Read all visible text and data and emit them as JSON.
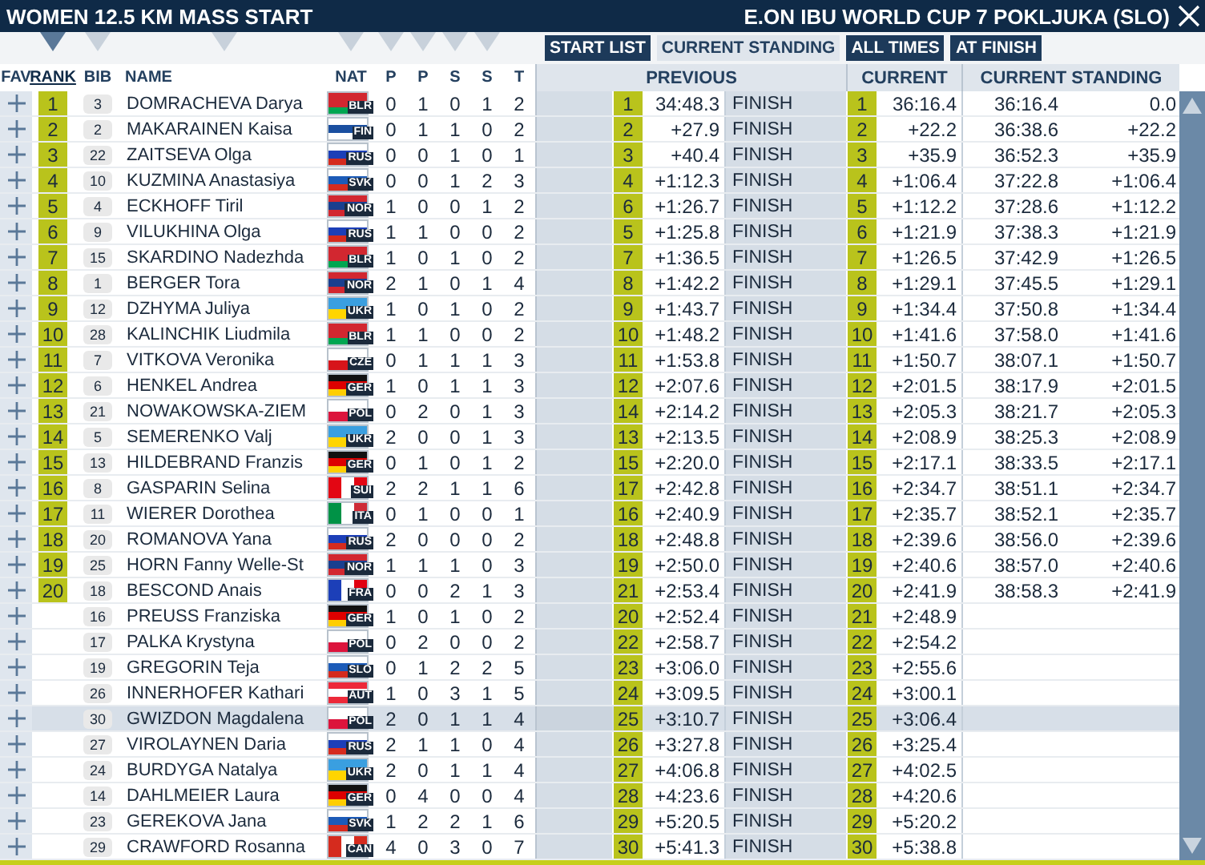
{
  "window": {
    "title": "WOMEN 12.5 KM MASS START",
    "event": "E.ON IBU WORLD CUP 7 POKLJUKA (SLO)"
  },
  "view_buttons": [
    {
      "label": "START LIST",
      "selected": false
    },
    {
      "label": "CURRENT STANDING",
      "selected": true
    },
    {
      "label": "ALL TIMES",
      "selected": false
    },
    {
      "label": "AT FINISH",
      "selected": false
    }
  ],
  "columns": [
    {
      "label": "FAV",
      "sortable": false,
      "selected": false
    },
    {
      "label": "RANK",
      "sortable": true,
      "selected": true
    },
    {
      "label": "BIB",
      "sortable": true,
      "selected": false
    },
    {
      "label": "NAME",
      "sortable": true,
      "selected": false
    },
    {
      "label": "NAT",
      "sortable": true,
      "selected": false
    },
    {
      "label": "P",
      "sortable": true,
      "selected": false
    },
    {
      "label": "P",
      "sortable": true,
      "selected": false
    },
    {
      "label": "S",
      "sortable": true,
      "selected": false
    },
    {
      "label": "S",
      "sortable": true,
      "selected": false
    },
    {
      "label": "T",
      "sortable": false,
      "selected": false
    }
  ],
  "groups": [
    {
      "label": "PREVIOUS"
    },
    {
      "label": "CURRENT"
    },
    {
      "label": "CURRENT STANDING"
    }
  ],
  "rows": [
    {
      "rank": "1",
      "bib": "3",
      "name": "DOMRACHEVA Darya",
      "nat": "BLR",
      "flag": [
        {
          "color": "#d22730"
        },
        {
          "color": "#d22730"
        },
        {
          "color": "#00a651"
        }
      ],
      "flag_vertical": false,
      "shots": [
        "0",
        "1",
        "0",
        "1"
      ],
      "total": "2",
      "prev_rank": "1",
      "prev_time": "34:48.3",
      "status": "FINISH",
      "cur_rank": "1",
      "cur_time": "36:16.4",
      "standing_time": "36:16.4",
      "standing_behind": "0.0",
      "selected": false
    },
    {
      "rank": "2",
      "bib": "2",
      "name": "MAKARAINEN Kaisa",
      "nat": "FIN",
      "flag": [
        {
          "color": "#ffffff"
        },
        {
          "color": "#1a4fa0"
        },
        {
          "color": "#ffffff"
        }
      ],
      "flag_vertical": false,
      "shots": [
        "0",
        "1",
        "1",
        "0"
      ],
      "total": "2",
      "prev_rank": "2",
      "prev_time": "+27.9",
      "status": "FINISH",
      "cur_rank": "2",
      "cur_time": "+22.2",
      "standing_time": "36:38.6",
      "standing_behind": "+22.2",
      "selected": false
    },
    {
      "rank": "3",
      "bib": "22",
      "name": "ZAITSEVA Olga",
      "nat": "RUS",
      "flag": [
        {
          "color": "#ffffff"
        },
        {
          "color": "#1c3fb8"
        },
        {
          "color": "#d52b1e"
        }
      ],
      "flag_vertical": false,
      "shots": [
        "0",
        "0",
        "1",
        "0"
      ],
      "total": "1",
      "prev_rank": "3",
      "prev_time": "+40.4",
      "status": "FINISH",
      "cur_rank": "3",
      "cur_time": "+35.9",
      "standing_time": "36:52.3",
      "standing_behind": "+35.9",
      "selected": false
    },
    {
      "rank": "4",
      "bib": "10",
      "name": "KUZMINA Anastasiya",
      "nat": "SVK",
      "flag": [
        {
          "color": "#ffffff"
        },
        {
          "color": "#1c5bb8"
        },
        {
          "color": "#d52b1e"
        }
      ],
      "flag_vertical": false,
      "shots": [
        "0",
        "0",
        "1",
        "2"
      ],
      "total": "3",
      "prev_rank": "4",
      "prev_time": "+1:12.3",
      "status": "FINISH",
      "cur_rank": "4",
      "cur_time": "+1:06.4",
      "standing_time": "37:22.8",
      "standing_behind": "+1:06.4",
      "selected": false
    },
    {
      "rank": "5",
      "bib": "4",
      "name": "ECKHOFF Tiril",
      "nat": "NOR",
      "flag": [
        {
          "color": "#d22730"
        },
        {
          "color": "#1a3f8f"
        },
        {
          "color": "#d22730"
        }
      ],
      "flag_vertical": false,
      "shots": [
        "1",
        "0",
        "0",
        "1"
      ],
      "total": "2",
      "prev_rank": "6",
      "prev_time": "+1:26.7",
      "status": "FINISH",
      "cur_rank": "5",
      "cur_time": "+1:12.2",
      "standing_time": "37:28.6",
      "standing_behind": "+1:12.2",
      "selected": false
    },
    {
      "rank": "6",
      "bib": "9",
      "name": "VILUKHINA Olga",
      "nat": "RUS",
      "flag": [
        {
          "color": "#ffffff"
        },
        {
          "color": "#1c3fb8"
        },
        {
          "color": "#d52b1e"
        }
      ],
      "flag_vertical": false,
      "shots": [
        "1",
        "1",
        "0",
        "0"
      ],
      "total": "2",
      "prev_rank": "5",
      "prev_time": "+1:25.8",
      "status": "FINISH",
      "cur_rank": "6",
      "cur_time": "+1:21.9",
      "standing_time": "37:38.3",
      "standing_behind": "+1:21.9",
      "selected": false
    },
    {
      "rank": "7",
      "bib": "15",
      "name": "SKARDINO Nadezhda",
      "nat": "BLR",
      "flag": [
        {
          "color": "#d22730"
        },
        {
          "color": "#d22730"
        },
        {
          "color": "#00a651"
        }
      ],
      "flag_vertical": false,
      "shots": [
        "1",
        "0",
        "1",
        "0"
      ],
      "total": "2",
      "prev_rank": "7",
      "prev_time": "+1:36.5",
      "status": "FINISH",
      "cur_rank": "7",
      "cur_time": "+1:26.5",
      "standing_time": "37:42.9",
      "standing_behind": "+1:26.5",
      "selected": false
    },
    {
      "rank": "8",
      "bib": "1",
      "name": "BERGER Tora",
      "nat": "NOR",
      "flag": [
        {
          "color": "#d22730"
        },
        {
          "color": "#1a3f8f"
        },
        {
          "color": "#d22730"
        }
      ],
      "flag_vertical": false,
      "shots": [
        "2",
        "1",
        "0",
        "1"
      ],
      "total": "4",
      "prev_rank": "8",
      "prev_time": "+1:42.2",
      "status": "FINISH",
      "cur_rank": "8",
      "cur_time": "+1:29.1",
      "standing_time": "37:45.5",
      "standing_behind": "+1:29.1",
      "selected": false
    },
    {
      "rank": "9",
      "bib": "12",
      "name": "DZHYMA Juliya",
      "nat": "UKR",
      "flag": [
        {
          "color": "#3a9fe0"
        },
        {
          "color": "#ffd500"
        }
      ],
      "flag_vertical": false,
      "shots": [
        "1",
        "0",
        "1",
        "0"
      ],
      "total": "2",
      "prev_rank": "9",
      "prev_time": "+1:43.7",
      "status": "FINISH",
      "cur_rank": "9",
      "cur_time": "+1:34.4",
      "standing_time": "37:50.8",
      "standing_behind": "+1:34.4",
      "selected": false
    },
    {
      "rank": "10",
      "bib": "28",
      "name": "KALINCHIK Liudmila",
      "nat": "BLR",
      "flag": [
        {
          "color": "#d22730"
        },
        {
          "color": "#d22730"
        },
        {
          "color": "#00a651"
        }
      ],
      "flag_vertical": false,
      "shots": [
        "1",
        "1",
        "0",
        "0"
      ],
      "total": "2",
      "prev_rank": "10",
      "prev_time": "+1:48.2",
      "status": "FINISH",
      "cur_rank": "10",
      "cur_time": "+1:41.6",
      "standing_time": "37:58.0",
      "standing_behind": "+1:41.6",
      "selected": false
    },
    {
      "rank": "11",
      "bib": "7",
      "name": "VITKOVA Veronika",
      "nat": "CZE",
      "flag": [
        {
          "color": "#ffffff"
        },
        {
          "color": "#d7141a"
        }
      ],
      "flag_vertical": false,
      "shots": [
        "0",
        "1",
        "1",
        "1"
      ],
      "total": "3",
      "prev_rank": "11",
      "prev_time": "+1:53.8",
      "status": "FINISH",
      "cur_rank": "11",
      "cur_time": "+1:50.7",
      "standing_time": "38:07.1",
      "standing_behind": "+1:50.7",
      "selected": false
    },
    {
      "rank": "12",
      "bib": "6",
      "name": "HENKEL Andrea",
      "nat": "GER",
      "flag": [
        {
          "color": "#111111"
        },
        {
          "color": "#dd0000"
        },
        {
          "color": "#ffce00"
        }
      ],
      "flag_vertical": false,
      "shots": [
        "1",
        "0",
        "1",
        "1"
      ],
      "total": "3",
      "prev_rank": "12",
      "prev_time": "+2:07.6",
      "status": "FINISH",
      "cur_rank": "12",
      "cur_time": "+2:01.5",
      "standing_time": "38:17.9",
      "standing_behind": "+2:01.5",
      "selected": false
    },
    {
      "rank": "13",
      "bib": "21",
      "name": "NOWAKOWSKA-ZIEM",
      "nat": "POL",
      "flag": [
        {
          "color": "#ffffff"
        },
        {
          "color": "#dc143c"
        }
      ],
      "flag_vertical": false,
      "shots": [
        "0",
        "2",
        "0",
        "1"
      ],
      "total": "3",
      "prev_rank": "14",
      "prev_time": "+2:14.2",
      "status": "FINISH",
      "cur_rank": "13",
      "cur_time": "+2:05.3",
      "standing_time": "38:21.7",
      "standing_behind": "+2:05.3",
      "selected": false
    },
    {
      "rank": "14",
      "bib": "5",
      "name": "SEMERENKO Valj",
      "nat": "UKR",
      "flag": [
        {
          "color": "#3a9fe0"
        },
        {
          "color": "#ffd500"
        }
      ],
      "flag_vertical": false,
      "shots": [
        "2",
        "0",
        "0",
        "1"
      ],
      "total": "3",
      "prev_rank": "13",
      "prev_time": "+2:13.5",
      "status": "FINISH",
      "cur_rank": "14",
      "cur_time": "+2:08.9",
      "standing_time": "38:25.3",
      "standing_behind": "+2:08.9",
      "selected": false
    },
    {
      "rank": "15",
      "bib": "13",
      "name": "HILDEBRAND Franzis",
      "nat": "GER",
      "flag": [
        {
          "color": "#111111"
        },
        {
          "color": "#dd0000"
        },
        {
          "color": "#ffce00"
        }
      ],
      "flag_vertical": false,
      "shots": [
        "0",
        "1",
        "0",
        "1"
      ],
      "total": "2",
      "prev_rank": "15",
      "prev_time": "+2:20.0",
      "status": "FINISH",
      "cur_rank": "15",
      "cur_time": "+2:17.1",
      "standing_time": "38:33.5",
      "standing_behind": "+2:17.1",
      "selected": false
    },
    {
      "rank": "16",
      "bib": "8",
      "name": "GASPARIN Selina",
      "nat": "SUI",
      "flag": [
        {
          "color": "#e30613"
        },
        {
          "color": "#ffffff"
        },
        {
          "color": "#e30613"
        }
      ],
      "flag_vertical": true,
      "shots": [
        "2",
        "2",
        "1",
        "1"
      ],
      "total": "6",
      "prev_rank": "17",
      "prev_time": "+2:42.8",
      "status": "FINISH",
      "cur_rank": "16",
      "cur_time": "+2:34.7",
      "standing_time": "38:51.1",
      "standing_behind": "+2:34.7",
      "selected": false
    },
    {
      "rank": "17",
      "bib": "11",
      "name": "WIERER Dorothea",
      "nat": "ITA",
      "flag": [
        {
          "color": "#009246"
        },
        {
          "color": "#ffffff"
        },
        {
          "color": "#ce2b37"
        }
      ],
      "flag_vertical": true,
      "shots": [
        "0",
        "1",
        "0",
        "0"
      ],
      "total": "1",
      "prev_rank": "16",
      "prev_time": "+2:40.9",
      "status": "FINISH",
      "cur_rank": "17",
      "cur_time": "+2:35.7",
      "standing_time": "38:52.1",
      "standing_behind": "+2:35.7",
      "selected": false
    },
    {
      "rank": "18",
      "bib": "20",
      "name": "ROMANOVA Yana",
      "nat": "RUS",
      "flag": [
        {
          "color": "#ffffff"
        },
        {
          "color": "#1c3fb8"
        },
        {
          "color": "#d52b1e"
        }
      ],
      "flag_vertical": false,
      "shots": [
        "2",
        "0",
        "0",
        "0"
      ],
      "total": "2",
      "prev_rank": "18",
      "prev_time": "+2:48.8",
      "status": "FINISH",
      "cur_rank": "18",
      "cur_time": "+2:39.6",
      "standing_time": "38:56.0",
      "standing_behind": "+2:39.6",
      "selected": false
    },
    {
      "rank": "19",
      "bib": "25",
      "name": "HORN Fanny Welle-St",
      "nat": "NOR",
      "flag": [
        {
          "color": "#d22730"
        },
        {
          "color": "#1a3f8f"
        },
        {
          "color": "#d22730"
        }
      ],
      "flag_vertical": false,
      "shots": [
        "1",
        "1",
        "1",
        "0"
      ],
      "total": "3",
      "prev_rank": "19",
      "prev_time": "+2:50.0",
      "status": "FINISH",
      "cur_rank": "19",
      "cur_time": "+2:40.6",
      "standing_time": "38:57.0",
      "standing_behind": "+2:40.6",
      "selected": false
    },
    {
      "rank": "20",
      "bib": "18",
      "name": "BESCOND Anais",
      "nat": "FRA",
      "flag": [
        {
          "color": "#1c3fb8"
        },
        {
          "color": "#ffffff"
        },
        {
          "color": "#e1000f"
        }
      ],
      "flag_vertical": true,
      "shots": [
        "0",
        "0",
        "2",
        "1"
      ],
      "total": "3",
      "prev_rank": "21",
      "prev_time": "+2:53.4",
      "status": "FINISH",
      "cur_rank": "20",
      "cur_time": "+2:41.9",
      "standing_time": "38:58.3",
      "standing_behind": "+2:41.9",
      "selected": false
    },
    {
      "bib": "16",
      "name": "PREUSS Franziska",
      "nat": "GER",
      "flag": [
        {
          "color": "#111111"
        },
        {
          "color": "#dd0000"
        },
        {
          "color": "#ffce00"
        }
      ],
      "flag_vertical": false,
      "shots": [
        "1",
        "0",
        "1",
        "0"
      ],
      "total": "2",
      "prev_rank": "20",
      "prev_time": "+2:52.4",
      "status": "FINISH",
      "cur_rank": "21",
      "cur_time": "+2:48.9",
      "selected": false
    },
    {
      "bib": "17",
      "name": "PALKA Krystyna",
      "nat": "POL",
      "flag": [
        {
          "color": "#ffffff"
        },
        {
          "color": "#dc143c"
        }
      ],
      "flag_vertical": false,
      "shots": [
        "0",
        "2",
        "0",
        "0"
      ],
      "total": "2",
      "prev_rank": "22",
      "prev_time": "+2:58.7",
      "status": "FINISH",
      "cur_rank": "22",
      "cur_time": "+2:54.2",
      "selected": false
    },
    {
      "bib": "19",
      "name": "GREGORIN Teja",
      "nat": "SLO",
      "flag": [
        {
          "color": "#ffffff"
        },
        {
          "color": "#1c5bb8"
        },
        {
          "color": "#d52b1e"
        }
      ],
      "flag_vertical": false,
      "shots": [
        "0",
        "1",
        "2",
        "2"
      ],
      "total": "5",
      "prev_rank": "23",
      "prev_time": "+3:06.0",
      "status": "FINISH",
      "cur_rank": "23",
      "cur_time": "+2:55.6",
      "selected": false
    },
    {
      "bib": "26",
      "name": "INNERHOFER Kathari",
      "nat": "AUT",
      "flag": [
        {
          "color": "#ed2939"
        },
        {
          "color": "#ffffff"
        },
        {
          "color": "#ed2939"
        }
      ],
      "flag_vertical": false,
      "shots": [
        "1",
        "0",
        "3",
        "1"
      ],
      "total": "5",
      "prev_rank": "24",
      "prev_time": "+3:09.5",
      "status": "FINISH",
      "cur_rank": "24",
      "cur_time": "+3:00.1",
      "selected": false
    },
    {
      "bib": "30",
      "name": "GWIZDON Magdalena",
      "nat": "POL",
      "flag": [
        {
          "color": "#ffffff"
        },
        {
          "color": "#dc143c"
        }
      ],
      "flag_vertical": false,
      "shots": [
        "2",
        "0",
        "1",
        "1"
      ],
      "total": "4",
      "prev_rank": "25",
      "prev_time": "+3:10.7",
      "status": "FINISH",
      "cur_rank": "25",
      "cur_time": "+3:06.4",
      "selected": true
    },
    {
      "bib": "27",
      "name": "VIROLAYNEN Daria",
      "nat": "RUS",
      "flag": [
        {
          "color": "#ffffff"
        },
        {
          "color": "#1c3fb8"
        },
        {
          "color": "#d52b1e"
        }
      ],
      "flag_vertical": false,
      "shots": [
        "2",
        "1",
        "1",
        "0"
      ],
      "total": "4",
      "prev_rank": "26",
      "prev_time": "+3:27.8",
      "status": "FINISH",
      "cur_rank": "26",
      "cur_time": "+3:25.4",
      "selected": false
    },
    {
      "bib": "24",
      "name": "BURDYGA Natalya",
      "nat": "UKR",
      "flag": [
        {
          "color": "#3a9fe0"
        },
        {
          "color": "#ffd500"
        }
      ],
      "flag_vertical": false,
      "shots": [
        "2",
        "0",
        "1",
        "1"
      ],
      "total": "4",
      "prev_rank": "27",
      "prev_time": "+4:06.8",
      "status": "FINISH",
      "cur_rank": "27",
      "cur_time": "+4:02.5",
      "selected": false
    },
    {
      "bib": "14",
      "name": "DAHLMEIER Laura",
      "nat": "GER",
      "flag": [
        {
          "color": "#111111"
        },
        {
          "color": "#dd0000"
        },
        {
          "color": "#ffce00"
        }
      ],
      "flag_vertical": false,
      "shots": [
        "0",
        "4",
        "0",
        "0"
      ],
      "total": "4",
      "prev_rank": "28",
      "prev_time": "+4:23.6",
      "status": "FINISH",
      "cur_rank": "28",
      "cur_time": "+4:20.6",
      "selected": false
    },
    {
      "bib": "23",
      "name": "GEREKOVA Jana",
      "nat": "SVK",
      "flag": [
        {
          "color": "#ffffff"
        },
        {
          "color": "#1c5bb8"
        },
        {
          "color": "#d52b1e"
        }
      ],
      "flag_vertical": false,
      "shots": [
        "1",
        "2",
        "2",
        "1"
      ],
      "total": "6",
      "prev_rank": "29",
      "prev_time": "+5:20.5",
      "status": "FINISH",
      "cur_rank": "29",
      "cur_time": "+5:20.2",
      "selected": false
    },
    {
      "bib": "29",
      "name": "CRAWFORD Rosanna",
      "nat": "CAN",
      "flag": [
        {
          "color": "#d52b1e"
        },
        {
          "color": "#ffffff"
        },
        {
          "color": "#d52b1e"
        }
      ],
      "flag_vertical": true,
      "shots": [
        "4",
        "0",
        "3",
        "0"
      ],
      "total": "7",
      "prev_rank": "30",
      "prev_time": "+5:41.3",
      "status": "FINISH",
      "cur_rank": "30",
      "cur_time": "+5:38.8",
      "selected": false
    }
  ]
}
